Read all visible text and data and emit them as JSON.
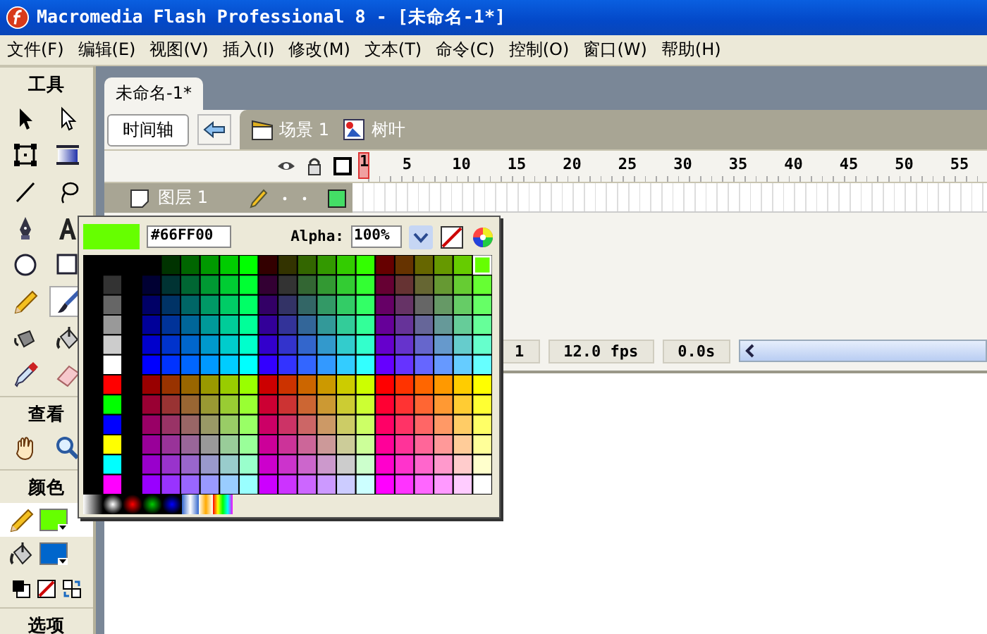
{
  "window": {
    "title": "Macromedia Flash Professional 8 - [未命名-1*]"
  },
  "menu": [
    {
      "label": "文件(F)"
    },
    {
      "label": "编辑(E)"
    },
    {
      "label": "视图(V)"
    },
    {
      "label": "插入(I)"
    },
    {
      "label": "修改(M)"
    },
    {
      "label": "文本(T)"
    },
    {
      "label": "命令(C)"
    },
    {
      "label": "控制(O)"
    },
    {
      "label": "窗口(W)"
    },
    {
      "label": "帮助(H)"
    }
  ],
  "toolbox": {
    "title": "工具",
    "tools": [
      {
        "kind": "arrow",
        "selected": false
      },
      {
        "kind": "subselect",
        "selected": false
      },
      {
        "kind": "transform",
        "selected": false
      },
      {
        "kind": "gradient",
        "selected": false
      },
      {
        "kind": "line",
        "selected": false
      },
      {
        "kind": "lasso",
        "selected": false
      },
      {
        "kind": "pen",
        "selected": false
      },
      {
        "kind": "text",
        "selected": false
      },
      {
        "kind": "oval",
        "selected": false
      },
      {
        "kind": "rectangle",
        "selected": false
      },
      {
        "kind": "pencil",
        "selected": false
      },
      {
        "kind": "brush",
        "selected": true
      },
      {
        "kind": "inkbottle",
        "selected": false
      },
      {
        "kind": "bucket",
        "selected": false
      },
      {
        "kind": "eyedropper",
        "selected": false
      },
      {
        "kind": "eraser",
        "selected": false
      }
    ],
    "view_label": "查看",
    "view_tools": [
      {
        "kind": "hand",
        "selected": false
      },
      {
        "kind": "zoom",
        "selected": false
      }
    ],
    "colors_label": "颜色",
    "stroke": {
      "color": "#66ff00"
    },
    "fill": {
      "color": "#0066cc"
    },
    "options_label": "选项"
  },
  "document_tab": {
    "label": "未命名-1*"
  },
  "edit_bar": {
    "timeline_button": "时间轴",
    "breadcrumbs": [
      {
        "kind": "scene",
        "label": "场景 1"
      },
      {
        "kind": "symbol",
        "label": "树叶"
      }
    ]
  },
  "timeline": {
    "frame_numbers": [
      {
        "label": "1",
        "selected": true
      },
      {
        "label": "5",
        "selected": false
      },
      {
        "label": "10",
        "selected": false
      },
      {
        "label": "15",
        "selected": false
      },
      {
        "label": "20",
        "selected": false
      },
      {
        "label": "25",
        "selected": false
      },
      {
        "label": "30",
        "selected": false
      },
      {
        "label": "35",
        "selected": false
      },
      {
        "label": "40",
        "selected": false
      },
      {
        "label": "45",
        "selected": false
      },
      {
        "label": "50",
        "selected": false
      },
      {
        "label": "55",
        "selected": false
      }
    ],
    "layers": [
      {
        "name": "图层 1",
        "selected": true
      }
    ],
    "status": {
      "frame": "1",
      "fps": "12.0 fps",
      "time": "0.0s"
    }
  },
  "color_picker": {
    "hex": "#66FF00",
    "alpha_label": "Alpha:",
    "alpha": "100%"
  }
}
